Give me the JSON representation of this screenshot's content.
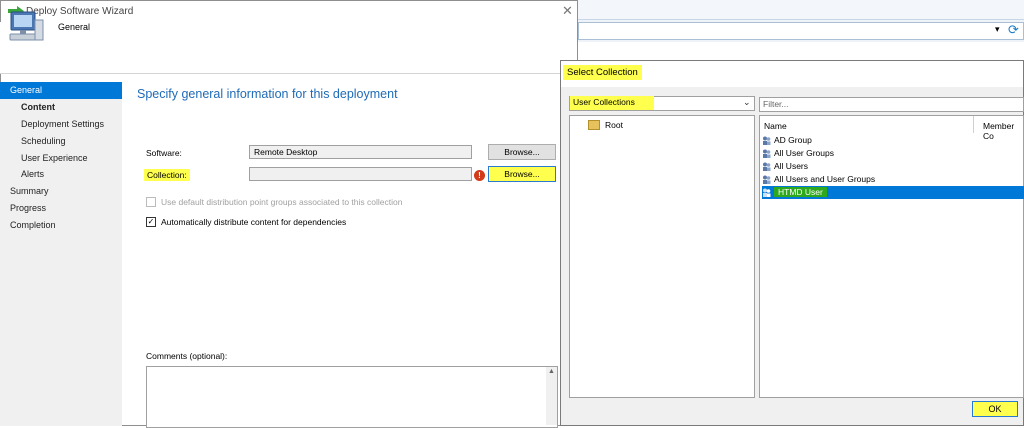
{
  "wizard": {
    "title": "Deploy Software Wizard",
    "close_glyph": "✕",
    "header_title": "General",
    "page_title": "Specify general information for this deployment",
    "nav": [
      {
        "label": "General"
      },
      {
        "label": "Content"
      },
      {
        "label": "Deployment Settings"
      },
      {
        "label": "Scheduling"
      },
      {
        "label": "User Experience"
      },
      {
        "label": "Alerts"
      },
      {
        "label": "Summary"
      },
      {
        "label": "Progress"
      },
      {
        "label": "Completion"
      }
    ],
    "software_label": "Software:",
    "software_value": "Remote Desktop",
    "browse_label": "Browse...",
    "collection_label": "Collection:",
    "collection_value": "",
    "error_glyph": "!",
    "use_default_dp_label": "Use default distribution point groups associated to this collection",
    "auto_distribute_label": "Automatically distribute content for dependencies",
    "check_glyph": "✓",
    "comments_label": "Comments (optional):",
    "comments_value": ""
  },
  "select_collection": {
    "title": "Select Collection",
    "collection_type": "User Collections",
    "tree_root": "Root",
    "filter_placeholder": "Filter...",
    "col_name": "Name",
    "col_member": "Member Co",
    "items": [
      {
        "name": "AD Group"
      },
      {
        "name": "All User Groups"
      },
      {
        "name": "All Users"
      },
      {
        "name": "All Users and User Groups"
      },
      {
        "name": "HTMD User"
      }
    ],
    "ok_label": "OK"
  },
  "colors": {
    "accent": "#0078d7",
    "highlight_yellow": "#ffff4d",
    "highlight_green": "#2ea81c",
    "title_blue": "#1e6bb8",
    "error_red": "#d23a19"
  }
}
